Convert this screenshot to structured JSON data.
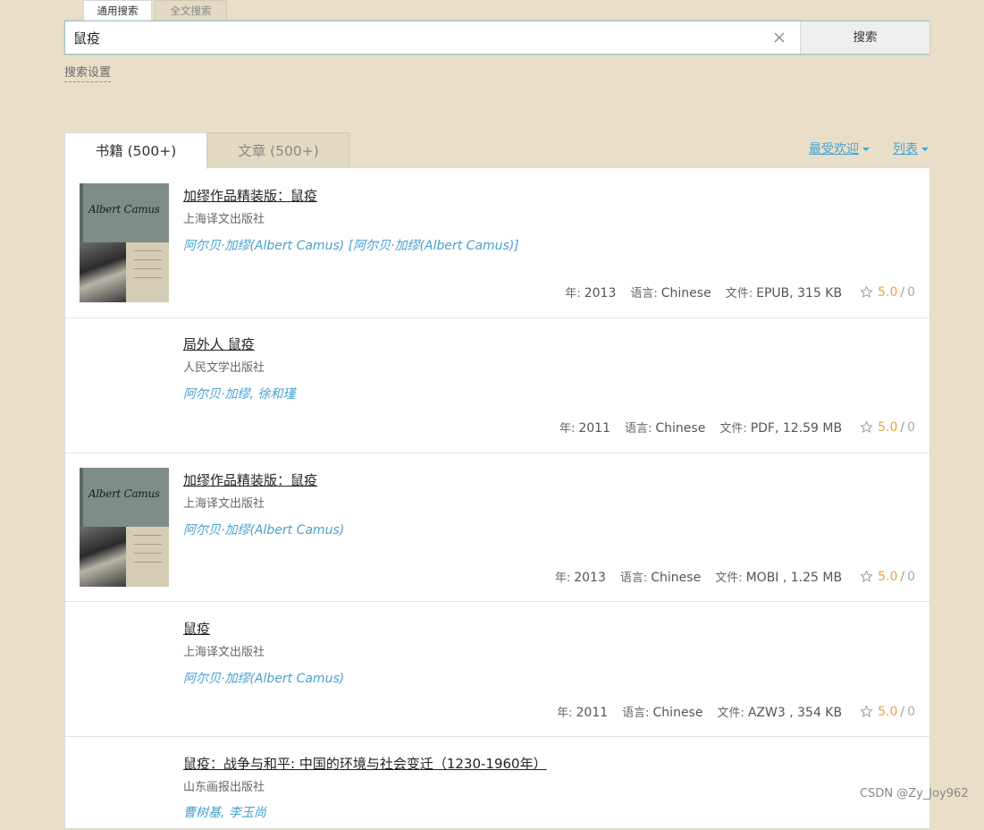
{
  "search_tabs": [
    "通用搜索",
    "全文搜索"
  ],
  "search": {
    "value": "鼠疫",
    "button_label": "搜索",
    "settings_label": "搜索设置"
  },
  "result_tabs": [
    "书籍 (500+)",
    "文章 (500+)"
  ],
  "sort_label": "最受欢迎",
  "view_label": "列表",
  "labels": {
    "year": "年:",
    "language": "语言:",
    "file": "文件:"
  },
  "cover_text": "Albert Camus",
  "results": [
    {
      "title": "加缪作品精装版：鼠疫",
      "publisher": "上海译文出版社",
      "authors": "阿尔贝·加缪(Albert Camus) [阿尔贝·加缪(Albert Camus)]",
      "year": "2013",
      "language": "Chinese",
      "file": "EPUB, 315 KB",
      "rating": "5.0",
      "rating_count": "0",
      "has_cover": true
    },
    {
      "title": "局外人 鼠疫",
      "publisher": "人民文学出版社",
      "authors": "阿尔贝·加缪, 徐和瑾",
      "year": "2011",
      "language": "Chinese",
      "file": "PDF, 12.59 MB",
      "rating": "5.0",
      "rating_count": "0",
      "has_cover": false
    },
    {
      "title": "加缪作品精装版：鼠疫",
      "publisher": "上海译文出版社",
      "authors": "阿尔贝·加缪(Albert Camus)",
      "year": "2013",
      "language": "Chinese",
      "file": "MOBI , 1.25 MB",
      "rating": "5.0",
      "rating_count": "0",
      "has_cover": true
    },
    {
      "title": "鼠疫",
      "publisher": "上海译文出版社",
      "authors": "阿尔贝·加缪(Albert Camus)",
      "year": "2011",
      "language": "Chinese",
      "file": "AZW3 , 354 KB",
      "rating": "5.0",
      "rating_count": "0",
      "has_cover": false
    },
    {
      "title": "鼠疫：战争与和平: 中国的环境与社会变迁（1230-1960年）",
      "publisher": "山东画报出版社",
      "authors": "曹树基, 李玉尚"
    }
  ],
  "watermark": "CSDN @Zy_Joy962",
  "colors": {
    "background": "#e9dfc9",
    "link": "#49a1cf",
    "rating": "#f0a03c"
  },
  "icons": {
    "clear": "close-icon",
    "star": "star-icon"
  }
}
